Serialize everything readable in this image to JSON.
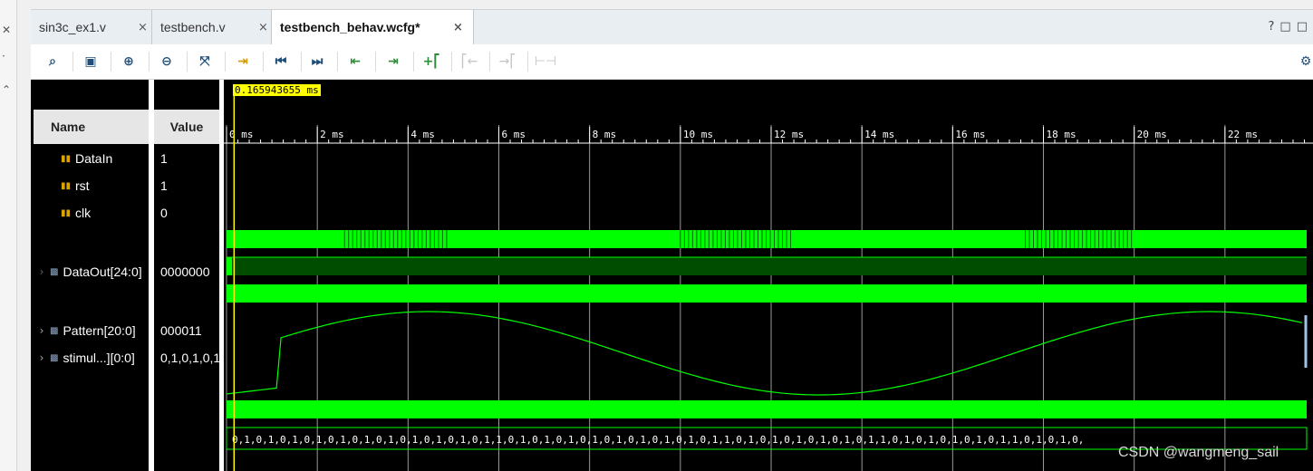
{
  "tabs": [
    {
      "label": "sin3c_ex1.v",
      "active": false
    },
    {
      "label": "testbench.v",
      "active": false
    },
    {
      "label": "testbench_behav.wcfg*",
      "active": true
    }
  ],
  "window_controls": {
    "help": "?",
    "restore": "□",
    "maximize": "□"
  },
  "toolbar_icons": [
    "search-icon",
    "save-icon",
    "zoom-in-icon",
    "zoom-out-icon",
    "zoom-fit-icon",
    "go-to-cursor-icon",
    "go-to-start-icon",
    "go-to-end-icon",
    "previous-transition-icon",
    "next-transition-icon",
    "add-marker-icon",
    "previous-marker-icon",
    "next-marker-icon",
    "swap-cursors-icon",
    "settings-icon"
  ],
  "headers": {
    "name": "Name",
    "value": "Value"
  },
  "cursor": {
    "time_label": "0.165943655 ms",
    "time_ms": 0.165943655
  },
  "timeline": {
    "unit": "ms",
    "ticks": [
      0,
      2,
      4,
      6,
      8,
      10,
      12,
      14,
      16,
      18,
      20,
      22
    ],
    "range_ms": [
      0,
      23.8
    ]
  },
  "signals": [
    {
      "name": "DataIn",
      "value": "1",
      "kind": "bit",
      "expandable": false,
      "selected": false
    },
    {
      "name": "rst",
      "value": "1",
      "kind": "bit",
      "expandable": false,
      "selected": false
    },
    {
      "name": "clk",
      "value": "0",
      "kind": "bit",
      "expandable": false,
      "selected": false
    },
    {
      "name": "DataOut[24:0]",
      "value": "0000000",
      "kind": "analog",
      "expandable": true,
      "selected": true
    },
    {
      "name": "Pattern[20:0]",
      "value": "000011",
      "kind": "bus",
      "expandable": true,
      "selected": false
    },
    {
      "name": "stimul...][0:0]",
      "value": "0,1,0,1,0,1",
      "kind": "array",
      "expandable": true,
      "selected": false
    }
  ],
  "stimulus_text": "0,1,0,1,0,1,0,1,0,1,0,1,0,1,0,1,0,1,0,1,0,1,1,0,1,0,1,0,1,0,1,0,1,0,1,0,1,0,1,0,1,1,0,1,0,1,0,1,0,1,0,1,0,1,1,0,1,0,1,0,1,0,1,0,1,1,0,1,0,1,0,",
  "colors": {
    "wave": "#00ff00",
    "wave_dark": "#004d00",
    "grid": "#9a9a9a",
    "cursor": "#ffff00",
    "background": "#000000"
  },
  "watermark": "CSDN @wangmeng_sail"
}
